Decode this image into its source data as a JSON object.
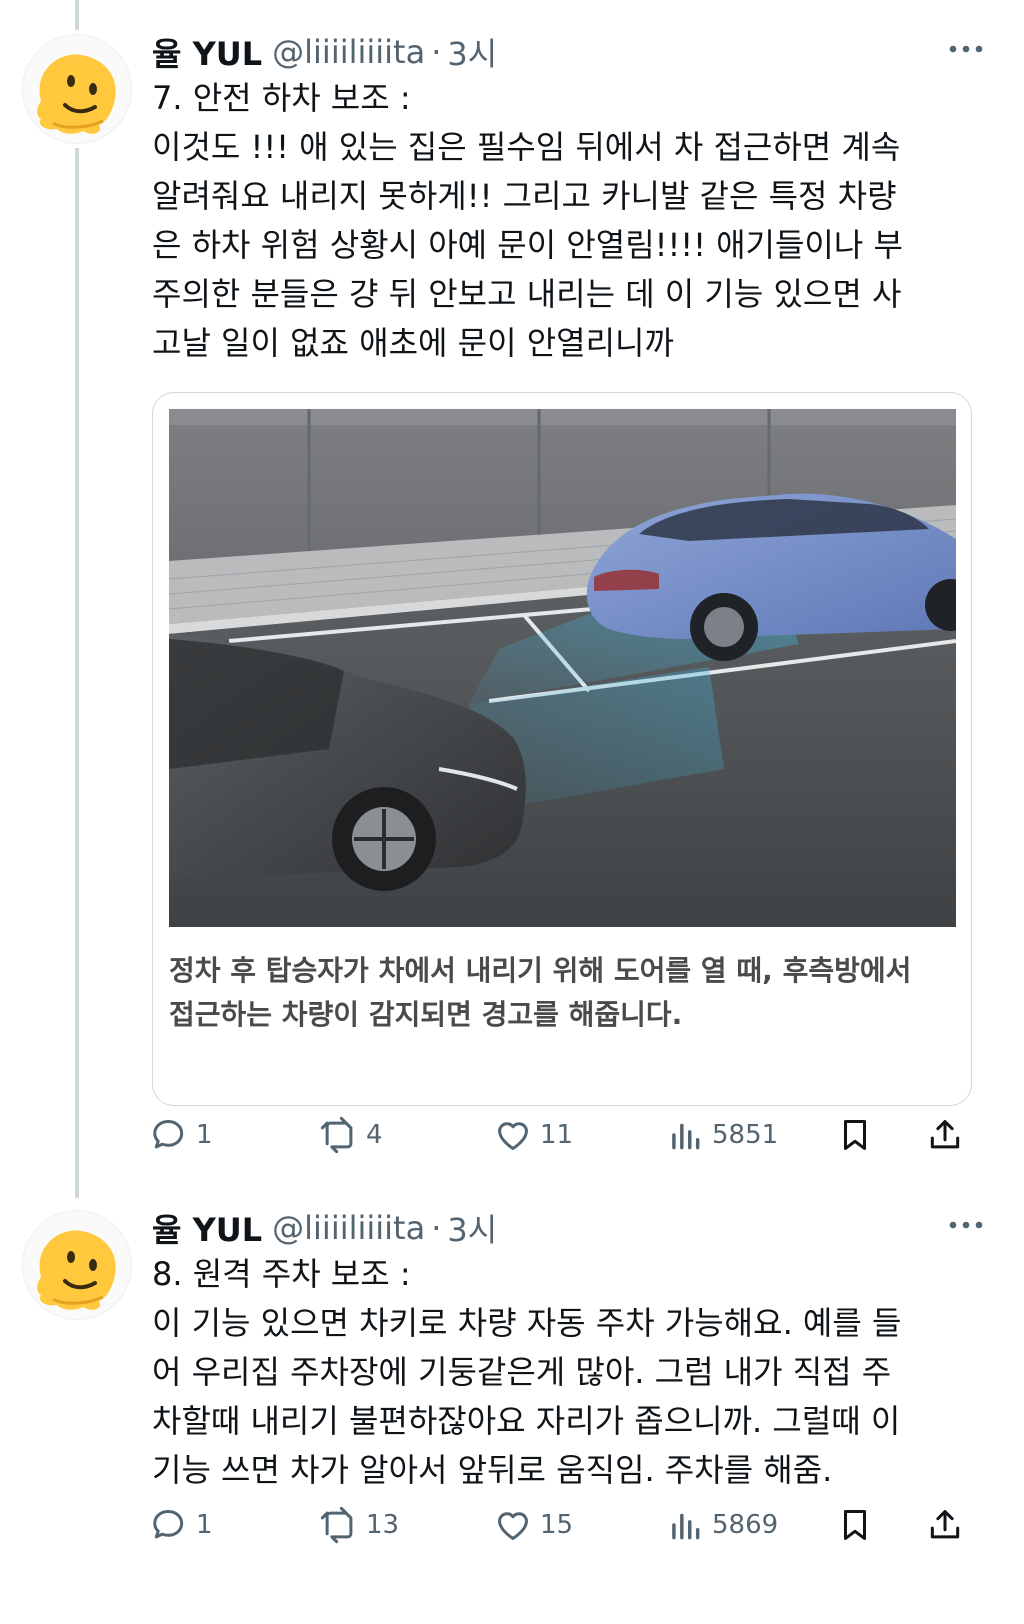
{
  "tweets": [
    {
      "author": {
        "display_name": "율 YUL",
        "handle": "@liiiiliiiita",
        "separator": "·",
        "time": "3시"
      },
      "lines": [
        "7. 안전 하차 보조 :",
        "이것도 !!! 애 있는 집은 필수임 뒤에서 차 접근하면 계속",
        "알려줘요 내리지 못하게!! 그리고 카니발 같은 특정 차량",
        "은 하차 위험 상황시 아예 문이 안열림!!!! 애기들이나 부",
        "주의한 분들은 걍 뒤 안보고 내리는 데 이 기능 있으면 사",
        "고날 일이 없죠 애초에 문이 안열리니까"
      ],
      "card": {
        "caption_lines": [
          "정차 후 탑승자가 차에서 내리기 위해 도어를 열 때, 후측방에서",
          "접근하는 차량이 감지되면 경고를 해줍니다."
        ]
      },
      "stats": {
        "replies": "1",
        "retweets": "4",
        "likes": "11",
        "views": "5851"
      }
    },
    {
      "author": {
        "display_name": "율 YUL",
        "handle": "@liiiiliiiita",
        "separator": "·",
        "time": "3시"
      },
      "lines": [
        "8. 원격 주차 보조 :",
        "이 기능 있으면 차키로 차량 자동 주차 가능해요. 예를 들",
        "어 우리집 주차장에 기둥같은게 많아. 그럼 내가 직접 주",
        "차할때 내리기 불편하잖아요 자리가 좁으니까. 그럴때 이",
        "기능 쓰면 차가 알아서 앞뒤로 움직임. 주차를 해줌."
      ],
      "stats": {
        "replies": "1",
        "retweets": "13",
        "likes": "15",
        "views": "5869"
      }
    }
  ],
  "colors": {
    "text": "#0f1419",
    "secondary": "#536471",
    "thread_line": "#cfd9de",
    "sensor_zone": "#3fb4dc"
  }
}
